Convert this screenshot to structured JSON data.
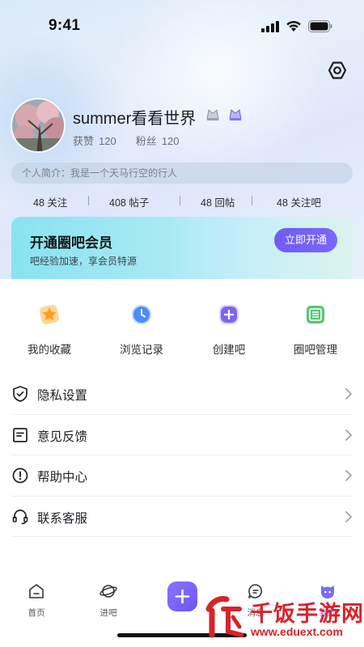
{
  "status_bar": {
    "time": "9:41"
  },
  "profile": {
    "username": "summer看看世界",
    "likes_label": "获赞",
    "likes_value": "120",
    "fans_label": "粉丝",
    "fans_value": "120",
    "bio": "个人简介：我是一个天马行空的行人"
  },
  "counts": [
    {
      "value": "48",
      "label": "关注"
    },
    {
      "value": "408",
      "label": "帖子"
    },
    {
      "value": "48",
      "label": "回帖"
    },
    {
      "value": "48",
      "label": "关注吧"
    }
  ],
  "membership": {
    "title": "开通圈吧会员",
    "subtitle": "吧经验加速，享会员特源",
    "button": "立即开通"
  },
  "quick_actions": [
    {
      "label": "我的收藏",
      "icon": "star-icon"
    },
    {
      "label": "浏览记录",
      "icon": "clock-icon"
    },
    {
      "label": "创建吧",
      "icon": "plus-icon"
    },
    {
      "label": "圈吧管理",
      "icon": "manage-icon"
    }
  ],
  "menu": [
    {
      "label": "隐私设置",
      "icon": "shield-icon"
    },
    {
      "label": "意见反馈",
      "icon": "feedback-icon"
    },
    {
      "label": "帮助中心",
      "icon": "help-icon"
    },
    {
      "label": "联系客服",
      "icon": "headset-icon"
    }
  ],
  "tabs": [
    {
      "label": "首页",
      "icon": "home-icon"
    },
    {
      "label": "进吧",
      "icon": "planet-icon"
    },
    {
      "label": "消息",
      "icon": "message-icon"
    },
    {
      "label": "我的",
      "icon": "me-icon",
      "active": true
    }
  ],
  "watermark": {
    "brand": "千饭手游网",
    "url": "www.eduext.com"
  },
  "colors": {
    "accent": "#7366f4",
    "member_banner": "#a9e9f4",
    "watermark": "#d8232a"
  }
}
